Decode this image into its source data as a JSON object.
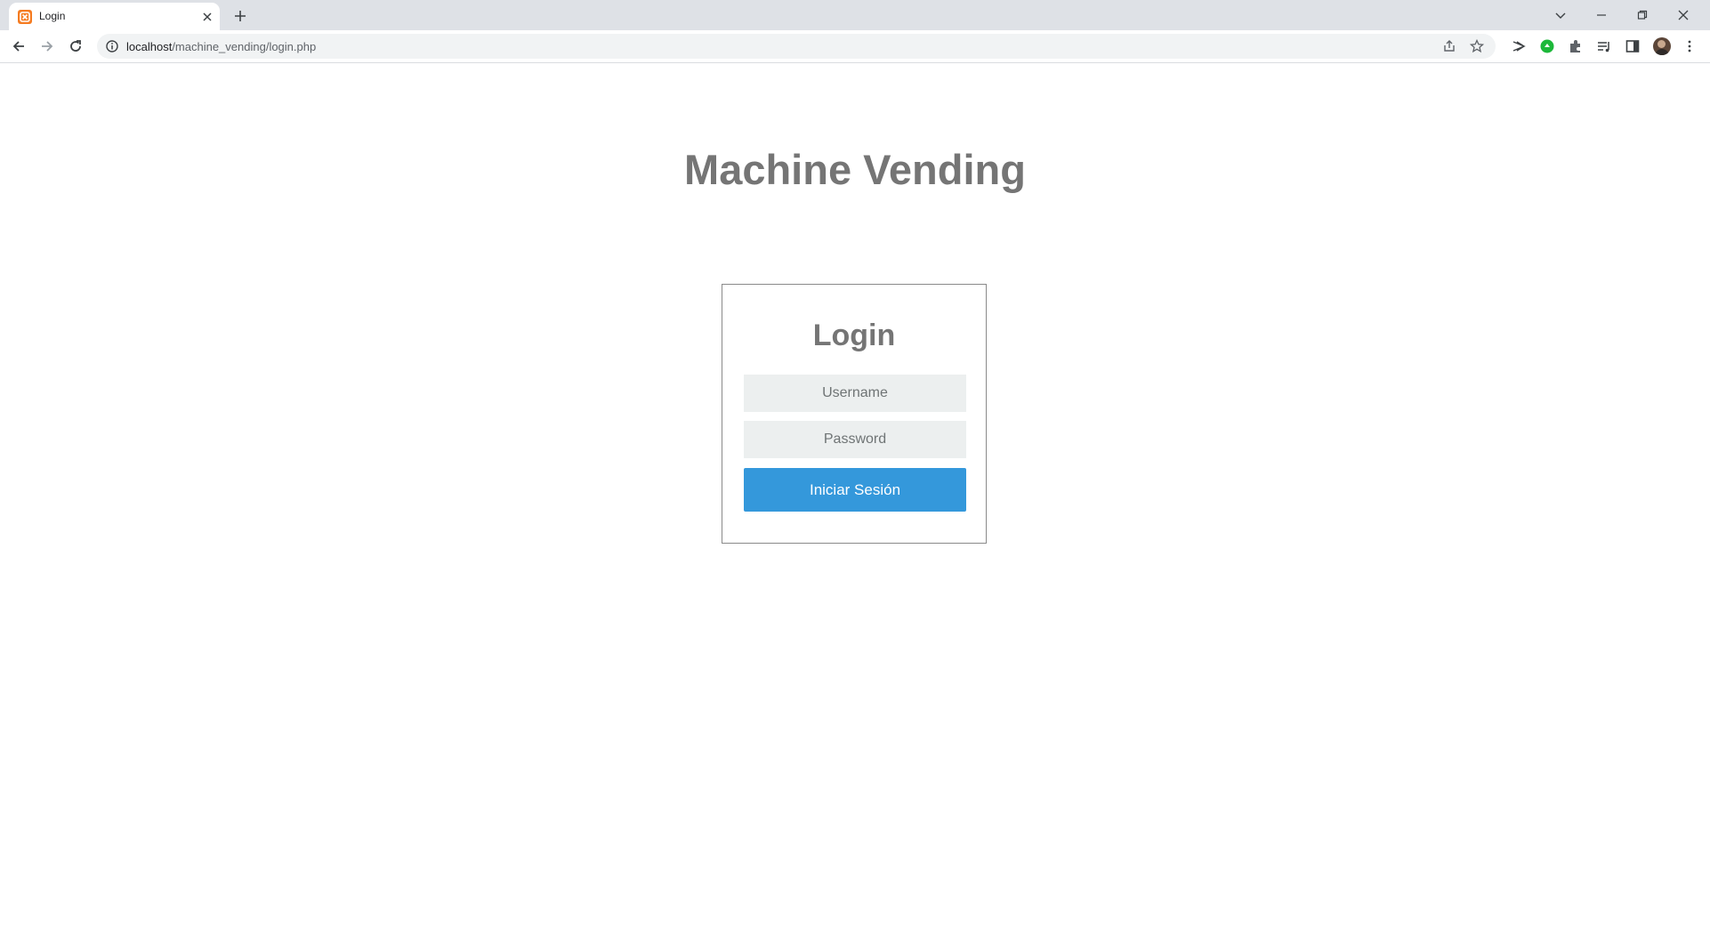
{
  "browser": {
    "tab_title": "Login",
    "url_host": "localhost",
    "url_path": "/machine_vending/login.php",
    "icons": {
      "favicon": "xampp-favicon-icon",
      "tab_close": "close-icon",
      "new_tab": "plus-icon",
      "back": "arrow-left-icon",
      "forward": "arrow-right-icon",
      "reload": "reload-icon",
      "site_info": "info-icon",
      "share": "share-icon",
      "bookmark": "star-icon",
      "extensions": [
        "send-extension-icon",
        "green-extension-icon",
        "puzzle-icon",
        "reading-list-icon",
        "side-panel-icon"
      ],
      "menu": "kebab-menu-icon"
    },
    "colors": {
      "tabbar": "#dee1e6",
      "omnibox": "#f1f3f4",
      "favicon": "#f57c22"
    }
  },
  "page": {
    "title": "Machine Vending",
    "login": {
      "heading": "Login",
      "username_placeholder": "Username",
      "password_placeholder": "Password",
      "submit_label": "Iniciar Sesión"
    },
    "colors": {
      "title": "#757575",
      "button": "#3498db",
      "input_bg": "#ecefef"
    }
  }
}
